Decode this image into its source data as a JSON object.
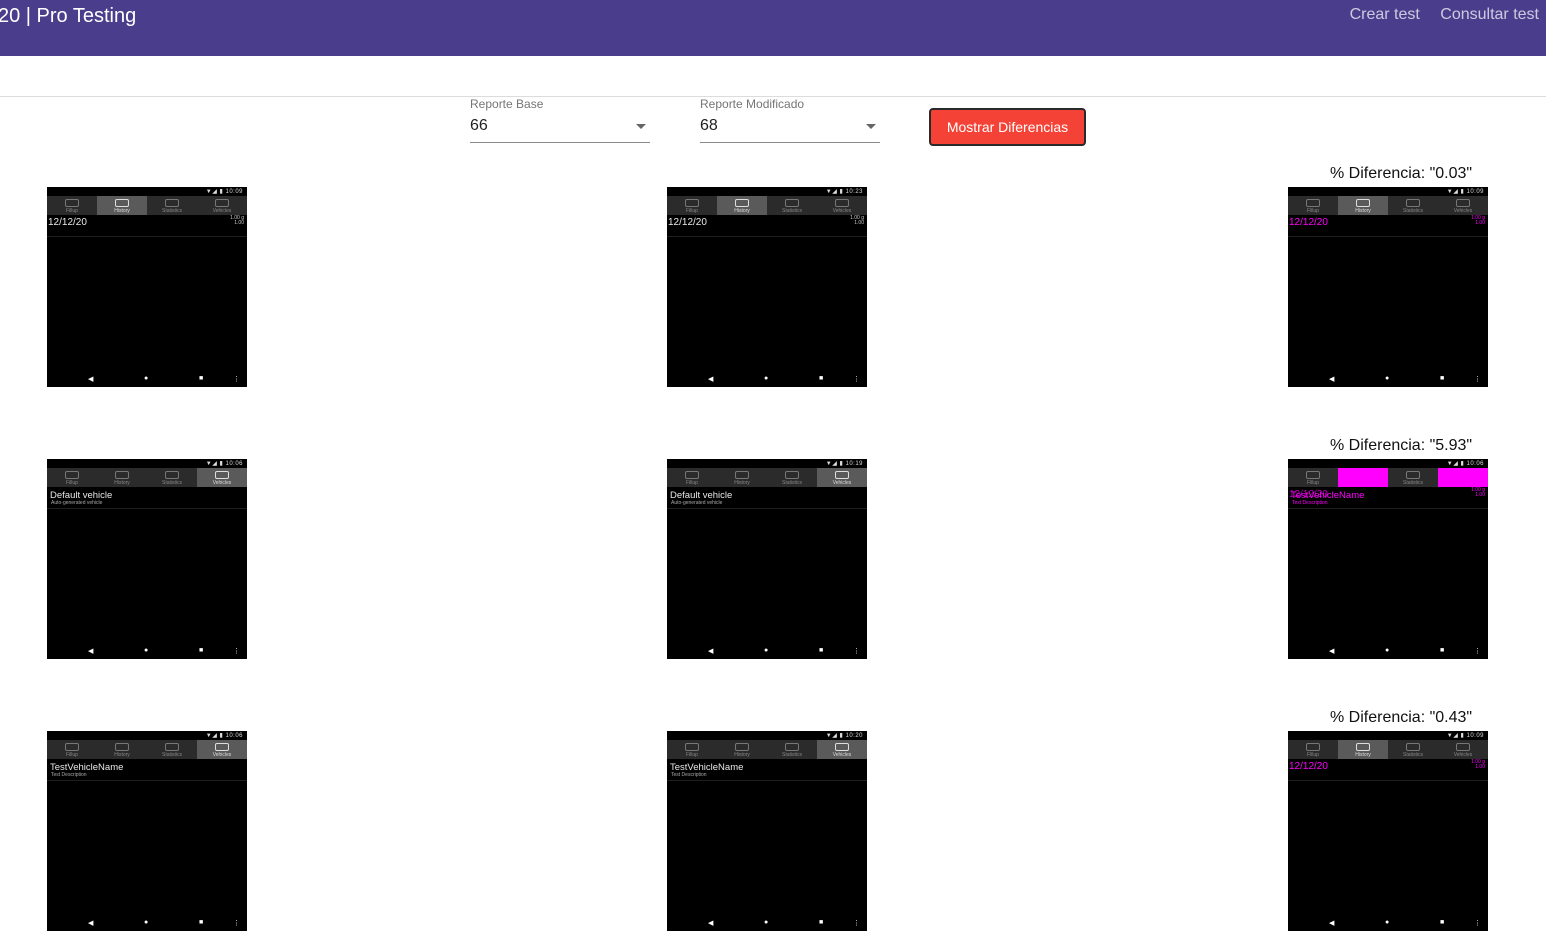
{
  "header": {
    "title": "20 | Pro Testing",
    "nav": [
      "Crear test",
      "Consultar test"
    ]
  },
  "controls": {
    "base_label": "Reporte Base",
    "base_value": "66",
    "mod_label": "Reporte Modificado",
    "mod_value": "68",
    "button_label": "Mostrar Diferencias"
  },
  "diff_prefix": "% Diferencia: ",
  "rows": [
    {
      "diff": "\"0.03\"",
      "base": {
        "time": "10:09",
        "text": "12/12/20",
        "sub": "",
        "nums": "1.00 g\n1.00",
        "active_tab": 1
      },
      "mod": {
        "time": "10:23",
        "text": "12/12/20",
        "sub": "",
        "nums": "1.00 g\n1.00",
        "active_tab": 1
      },
      "diffimg": {
        "time": "10:09",
        "text": "12/12/20",
        "sub": "",
        "nums": "1.00 g\n1.00",
        "active_tab": 1
      }
    },
    {
      "diff": "\"5.93\"",
      "base": {
        "time": "10:06",
        "text": "Default vehicle",
        "sub": "Auto-generated vehicle",
        "nums": "",
        "active_tab": 3
      },
      "mod": {
        "time": "10:19",
        "text": "Default vehicle",
        "sub": "Auto-generated vehicle",
        "nums": "",
        "active_tab": 3
      },
      "diffimg": {
        "time": "10:06",
        "text": "TestVehicleName",
        "sub": "Test Description",
        "nums": "1.00 g\n1.00",
        "active_tab": -1
      }
    },
    {
      "diff": "\"0.43\"",
      "base": {
        "time": "10:06",
        "text": "TestVehicleName",
        "sub": "Test Description",
        "nums": "",
        "active_tab": 3
      },
      "mod": {
        "time": "10:20",
        "text": "TestVehicleName",
        "sub": "Test Description",
        "nums": "",
        "active_tab": 3
      },
      "diffimg": {
        "time": "10:09",
        "text": "12/12/20",
        "sub": "",
        "nums": "1.00 g\n1.00",
        "active_tab": 1
      }
    }
  ],
  "tab_names": [
    "Fillup",
    "History",
    "Statistics",
    "Vehicles"
  ],
  "colors": {
    "header": "#4a3e8c",
    "button": "#f44336",
    "diff_highlight": "#ff00ff"
  }
}
